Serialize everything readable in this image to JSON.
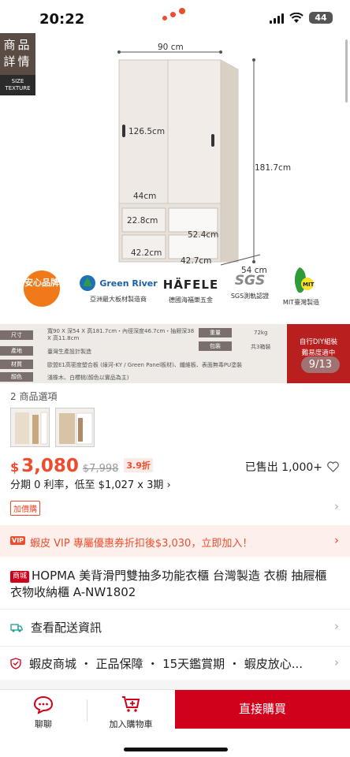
{
  "status": {
    "time": "20:22",
    "battery": "44"
  },
  "hero": {
    "side_tag": {
      "line1": "商品",
      "line2": "詳情",
      "sub1": "SIZE",
      "sub2": "TEXTURE"
    },
    "dims": {
      "width": "90 cm",
      "door_h": "126.5cm",
      "height": "181.7cm",
      "inner_w": "44cm",
      "drawer_w": "22.8cm",
      "shelf_w": "52.4cm",
      "bottom_w": "42.2cm",
      "bottom_w2": "42.7cm",
      "depth": "54 cm"
    },
    "brands": [
      {
        "name": "安心品牌",
        "caption": ""
      },
      {
        "name": "Green River",
        "caption": "亞洲最大板材製造商"
      },
      {
        "name": "HÄFELE",
        "caption": "德國海福樂五金"
      },
      {
        "name": "SGS",
        "caption": "SGS測軌認證"
      },
      {
        "name": "MIT",
        "caption": "MIT臺灣製造"
      }
    ]
  },
  "spec": {
    "rows": [
      {
        "label": "尺寸",
        "value": "寬90 X 深54 X 高181.7cm・內徑深度46.7cm・抽屜深38 X 高11.8cm"
      },
      {
        "label": "產地",
        "value": "臺灣生產設計製造"
      },
      {
        "label": "材質",
        "value": "歐盟E1高密度塑合板 (綠河-KY / Green Panel板材)、纖維板、表面無毒PU塗裝"
      },
      {
        "label": "顏色",
        "value": "淺橡木、白櫻桃(顏色以實品為主)"
      }
    ],
    "weight_label": "重量",
    "weight": "72kg",
    "pack_label": "包裝",
    "pack": "共3箱裝",
    "red_text_1": "自行DIY組裝",
    "red_text_2": "難易度適中"
  },
  "pager": "9/13",
  "options": {
    "label": "2 商品選項"
  },
  "price": {
    "currency": "$",
    "current": "3,080",
    "original": "$7,998",
    "discount": "3.9折"
  },
  "sold": "已售出 1,000+",
  "installment": "分期 0 利率，低至 $1,027 x 3期 ›",
  "addon": "加價購",
  "vip": {
    "badge": "VIP",
    "text": "蝦皮 VIP 專屬優惠券折扣後$3,030，立即加入！"
  },
  "product": {
    "mall_badge": "商城",
    "title": "HOPMA 美背滑門雙抽多功能衣櫃 台灣製造 衣櫥 抽屜櫃 衣物收納櫃 A-NW1802"
  },
  "shipping": "查看配送資訊",
  "guarantee": "蝦皮商城 ・ 正品保障 ・ 15天鑑賞期 ・ 蝦皮放心...",
  "bottom": {
    "chat": "聊聊",
    "cart": "加入購物車",
    "buy": "直接購買"
  },
  "colors": {
    "accent": "#ee4d2d",
    "mall": "#d0011b"
  }
}
